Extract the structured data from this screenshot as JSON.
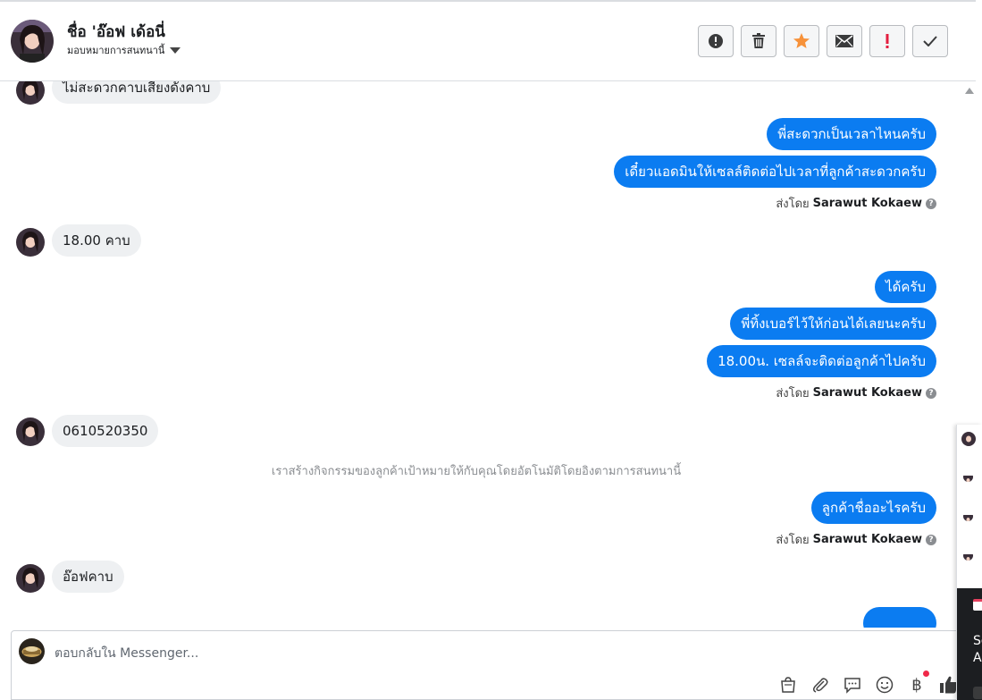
{
  "header": {
    "name": "ชื่อ 'อ๊อฟ เด้อนี่",
    "subtitle": "มอบหมายการสนทนานี้",
    "actions": [
      {
        "name": "spam-icon",
        "label": "!"
      },
      {
        "name": "trash-icon"
      },
      {
        "name": "star-icon"
      },
      {
        "name": "mail-icon"
      },
      {
        "name": "important-icon",
        "label": "!"
      },
      {
        "name": "check-icon"
      }
    ]
  },
  "messages": {
    "m1": "ไม่สะดวกคาบเสียงดังคาบ",
    "m2": "พี่สะดวกเป็นเวลาไหนครับ",
    "m3": "เดี๋ยวแอดมินให้เซลล์ติดต่อไปเวลาที่ลูกค้าสะดวกครับ",
    "m4": "18.00 คาบ",
    "m5": "ได้ครับ",
    "m6": "พี่ทิ้งเบอร์ไว้ให้ก่อนได้เลยนะครับ",
    "m7": "18.00น. เซลล์จะติดต่อลูกค้าไปครับ",
    "m8": "0610520350",
    "m9": "ลูกค้าชื่ออะไรครับ",
    "m10": "อ๊อฟคาบ"
  },
  "sent_by": {
    "prefix": "ส่งโดย",
    "agent": "Sarawut Kokaew",
    "help": "?"
  },
  "system_note": "เราสร้างกิจกรรมของลูกค้าเป้าหมายให้กับคุณโดยอัตโนมัติโดยอิงตามการสนทนานี้",
  "composer": {
    "placeholder": "ตอบกลับใน Messenger...",
    "icons": [
      "shopping-bag-icon",
      "paperclip-icon",
      "saved-reply-icon",
      "emoji-icon",
      "baht-icon",
      "like-icon"
    ],
    "baht_symbol": "฿"
  },
  "side_panel": {
    "text_1": "So",
    "text_2": "Ac"
  },
  "colors": {
    "outgoing_bubble": "#0b7cf1",
    "incoming_bubble": "#eef0f2",
    "star": "#f7923a",
    "important": "#e41e3f",
    "notification_dot": "#f02849"
  }
}
